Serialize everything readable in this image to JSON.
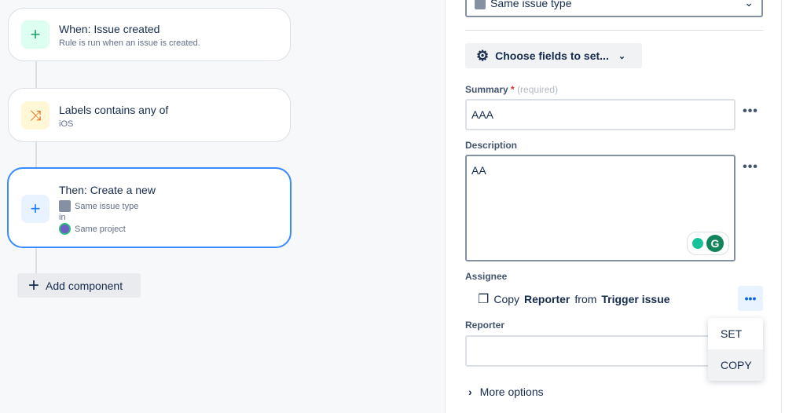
{
  "flow": {
    "trigger": {
      "title": "When: Issue created",
      "subtitle": "Rule is run when an issue is created."
    },
    "condition": {
      "title": "Labels contains any of",
      "subtitle": "iOS"
    },
    "action": {
      "title": "Then: Create a new",
      "issue_type": "Same issue type",
      "in": "in",
      "project": "Same project"
    },
    "add_component": "Add component"
  },
  "panel": {
    "issue_type_select": "Same issue type",
    "choose_fields": "Choose fields to set...",
    "summary": {
      "label": "Summary",
      "required_mark": "*",
      "required_text": "(required)",
      "value": "AAA"
    },
    "description": {
      "label": "Description",
      "value": "AA"
    },
    "assignee": {
      "label": "Assignee",
      "copy": "Copy",
      "field": "Reporter",
      "from": "from",
      "source": "Trigger issue"
    },
    "reporter": {
      "label": "Reporter",
      "value": ""
    },
    "more_options": "More options",
    "menu": [
      "SET",
      "COPY"
    ]
  },
  "colors": {
    "accent": "#388bff",
    "trigger_bg": "#dcfff1",
    "condition_bg": "#fff7d6",
    "action_bg": "#e9f2ff"
  }
}
